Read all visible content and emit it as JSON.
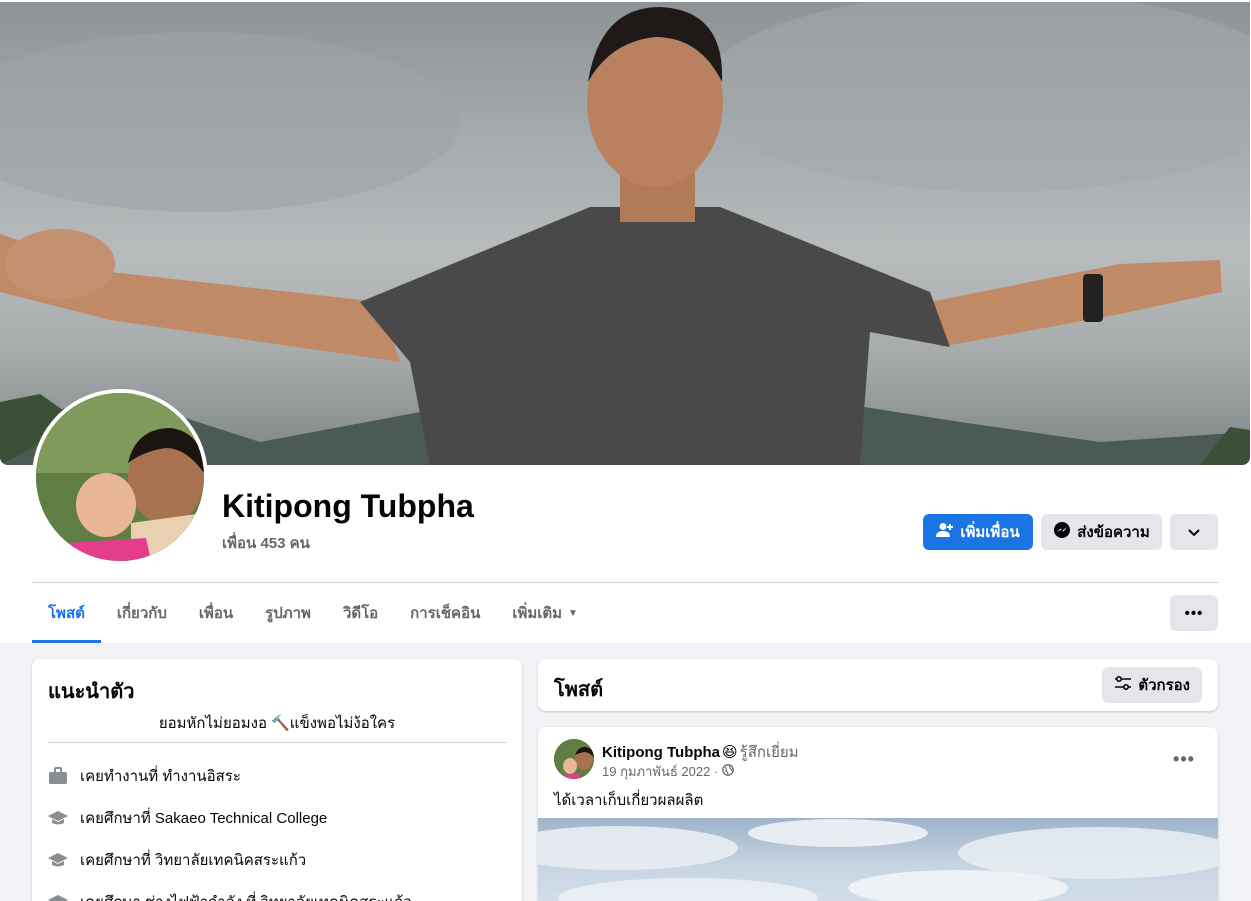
{
  "profile": {
    "name": "Kitipong Tubpha",
    "friends": "เพื่อน 453 คน"
  },
  "actions": {
    "add_friend": "เพิ่มเพื่อน",
    "message": "ส่งข้อความ"
  },
  "tabs": [
    {
      "label": "โพสต์",
      "active": true
    },
    {
      "label": "เกี่ยวกับ",
      "active": false
    },
    {
      "label": "เพื่อน",
      "active": false
    },
    {
      "label": "รูปภาพ",
      "active": false
    },
    {
      "label": "วิดีโอ",
      "active": false
    },
    {
      "label": "การเช็คอิน",
      "active": false
    },
    {
      "label": "เพิ่มเติม",
      "active": false
    }
  ],
  "intro": {
    "title": "แนะนำตัว",
    "bio": "ยอมหักไม่ยอมงอ 🔨แข็งพอไม่ง้อใคร",
    "items": [
      {
        "icon": "briefcase-icon",
        "text": "เคยทำงานที่ ทำงานอิสระ"
      },
      {
        "icon": "graduation-cap-icon",
        "text": "เคยศึกษาที่ Sakaeo Technical College"
      },
      {
        "icon": "graduation-cap-icon",
        "text": "เคยศึกษาที่ วิทยาลัยเทคนิคสระแก้ว"
      },
      {
        "icon": "graduation-cap-icon",
        "text": "เคยศึกษา ช่างไฟฟ้ากำลัง ที่ วิทยาลัยเทคนิคสระแก้ว"
      }
    ]
  },
  "posts": {
    "title": "โพสต์",
    "filter_label": "ตัวกรอง"
  },
  "post": {
    "author": "Kitipong Tubpha",
    "emoji": "😆",
    "feeling": "รู้สึกเยี่ยม",
    "date": "19 กุมภาพันธ์ 2022 ·",
    "text": "ได้เวลาเก็บเกี่ยวผลผลิต"
  },
  "colors": {
    "accent": "#1b74e4",
    "secondary_button": "#e4e6eb",
    "page_bg": "#f0f2f5"
  }
}
